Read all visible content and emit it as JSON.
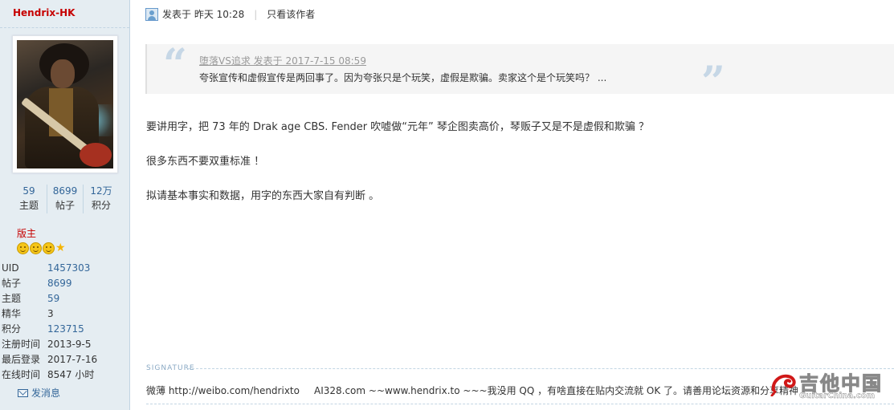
{
  "author": {
    "username": "Hendrix-HK",
    "stats": [
      {
        "value": "59",
        "label": "主题"
      },
      {
        "value": "8699",
        "label": "帖子"
      },
      {
        "value": "12万",
        "label": "积分"
      }
    ],
    "rank": "版主",
    "profile": [
      {
        "key": "UID",
        "value": "1457303"
      },
      {
        "key": "帖子",
        "value": "8699"
      },
      {
        "key": "主题",
        "value": "59"
      },
      {
        "key": "精华",
        "value": "3"
      },
      {
        "key": "积分",
        "value": "123715"
      },
      {
        "key": "注册时间",
        "value": "2013-9-5"
      },
      {
        "key": "最后登录",
        "value": "2017-7-16"
      },
      {
        "key": "在线时间",
        "value": "8547 小时"
      }
    ],
    "send_message": "发消息"
  },
  "post": {
    "posted_at": "发表于 昨天 10:28",
    "only_author": "只看该作者",
    "quote": {
      "header": "堕落VS追求 发表于 2017-7-15 08:59",
      "body": "夸张宣传和虚假宣传是两回事了。因为夸张只是个玩笑，虚假是欺骗。卖家这个是个玩笑吗？ ..."
    },
    "paragraphs": [
      "要讲用字，把 73 年的 Drak age CBS. Fender 吹嘘做“元年” 琴企图卖高价，琴贩子又是不是虚假和欺骗 ？",
      "很多东西不要双重标准 ！",
      "拟请基本事实和数据，用字的东西大家自有判断 。"
    ],
    "signature_label": "SIGNATURE",
    "signature": {
      "weibo": "微薄  http://weibo.com/hendrixto",
      "ai": "AI328.com ~~www.hendrix.to ~~~我没用 QQ ，有啥直接在贴内交流就 OK 了。请善用论坛资源和分享精神"
    }
  },
  "watermark": {
    "cn": "吉他中国",
    "en": "GuitarChina.com"
  },
  "colors": {
    "sidebar_bg": "#e5edf2",
    "username": "#c60000",
    "link": "#336699",
    "quote_bg": "#f5f5f5"
  }
}
